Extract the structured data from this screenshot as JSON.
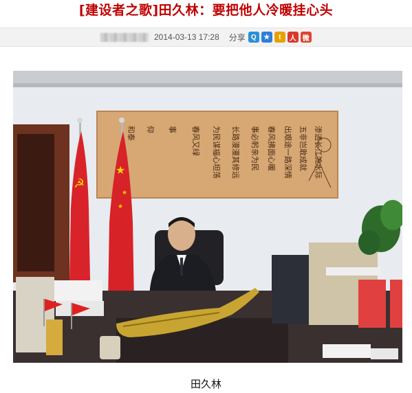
{
  "headline": "[建设者之歌]田久林：要把他人冷暖挂心头",
  "meta": {
    "date": "2014-03-13 17:28",
    "share_label": "分享"
  },
  "share_icons": [
    {
      "name": "qzone-share-icon",
      "glyph": "Q",
      "color": "#2a8fd6"
    },
    {
      "name": "qq-share-icon",
      "glyph": "★",
      "color": "#2d7fd8"
    },
    {
      "name": "tencent-weibo-share-icon",
      "glyph": "t",
      "color": "#e8a100"
    },
    {
      "name": "renren-share-icon",
      "glyph": "人",
      "color": "#d9382a"
    },
    {
      "name": "sina-weibo-share-icon",
      "glyph": "微",
      "color": "#e0442f"
    }
  ],
  "photo": {
    "calligraphy": "渗透长江流水际 五非岂敢成就 出艰途一路深情 春风拂面心暖 事必躬亲为民 仰"
  },
  "caption": "田久林"
}
